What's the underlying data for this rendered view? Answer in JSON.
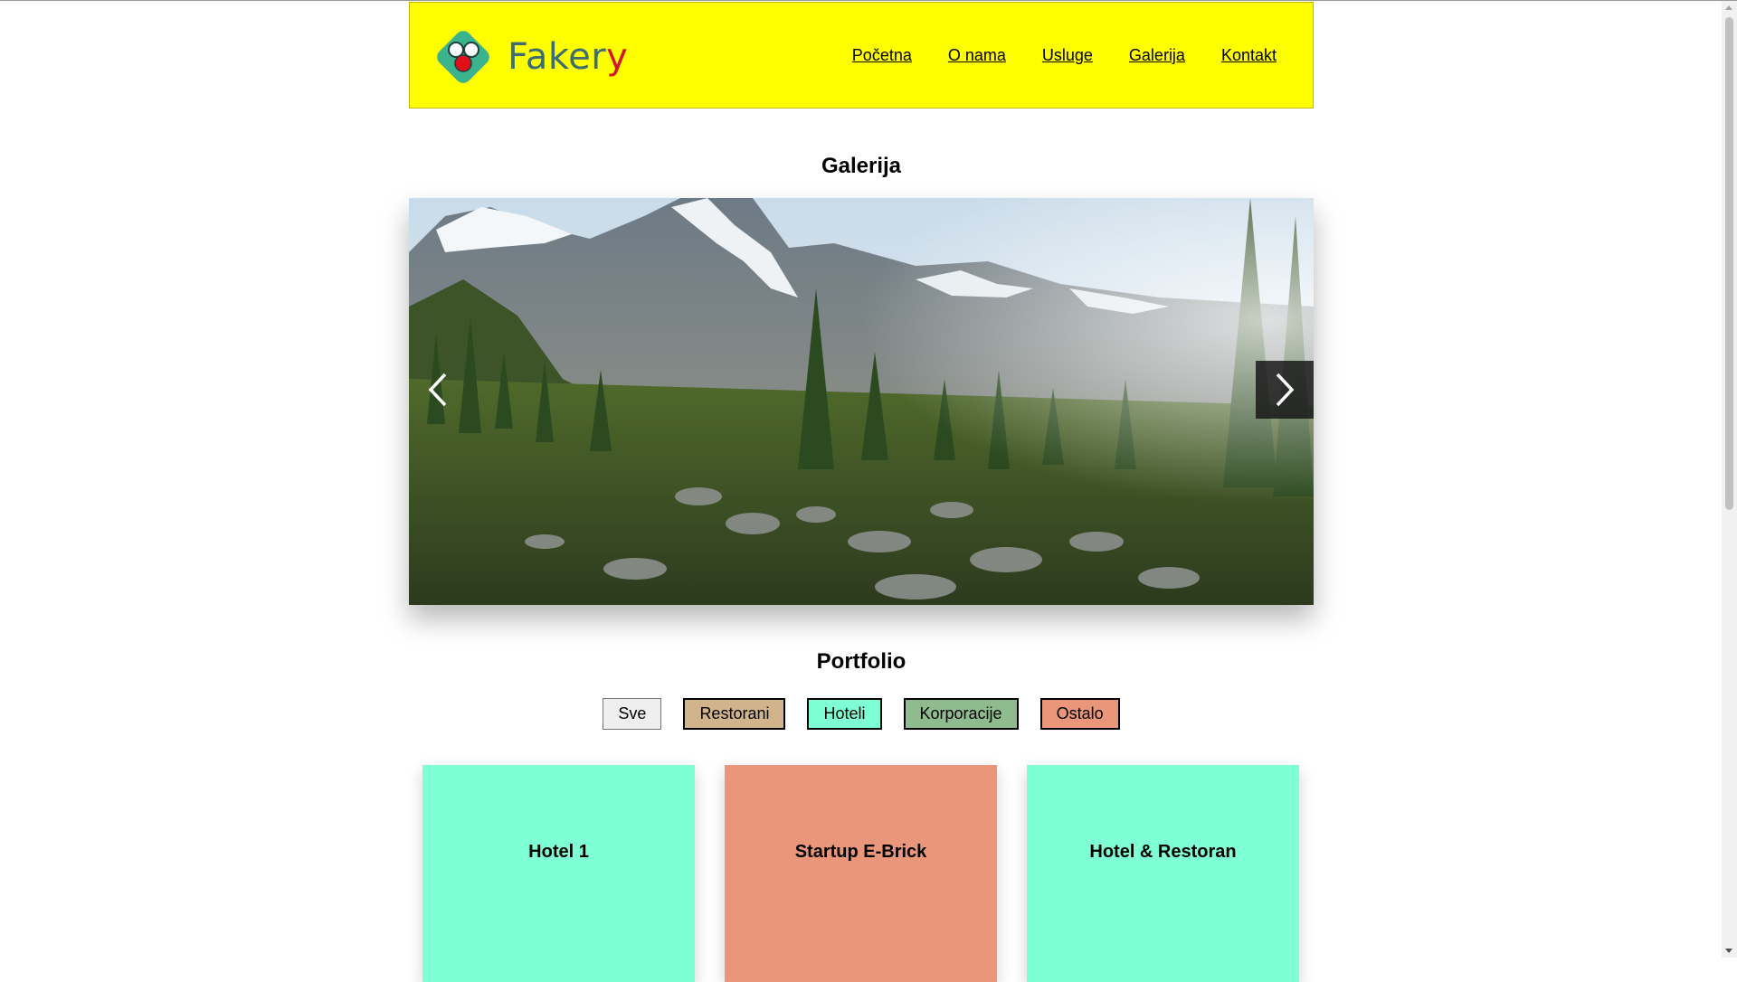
{
  "brand": {
    "name_main": "Faker",
    "name_accent": "y",
    "header_bg": "#ffff00",
    "logo_green": "#3bb38c",
    "logo_red": "#e0101a"
  },
  "nav": [
    {
      "label": "Početna"
    },
    {
      "label": "O nama"
    },
    {
      "label": "Usluge"
    },
    {
      "label": "Galerija"
    },
    {
      "label": "Kontakt"
    }
  ],
  "gallery": {
    "title": "Galerija",
    "slide_subject": "mountain landscape photo",
    "prev_icon": "chevron-left-icon",
    "next_icon": "chevron-right-icon"
  },
  "portfolio": {
    "title": "Portfolio",
    "filters": [
      {
        "label": "Sve",
        "color": "#efefef",
        "border": "#767676"
      },
      {
        "label": "Restorani",
        "color": "#d2b48c",
        "border": "#000000"
      },
      {
        "label": "Hoteli",
        "color": "#7fffd4",
        "border": "#000000"
      },
      {
        "label": "Korporacije",
        "color": "#8fbc8f",
        "border": "#000000"
      },
      {
        "label": "Ostalo",
        "color": "#e9967a",
        "border": "#000000"
      }
    ],
    "items": [
      {
        "label": "Hotel 1",
        "color": "#7fffd4"
      },
      {
        "label": "Startup E-Brick",
        "color": "#e9967a"
      },
      {
        "label": "Hotel & Restoran",
        "color": "#7fffd4"
      }
    ]
  }
}
